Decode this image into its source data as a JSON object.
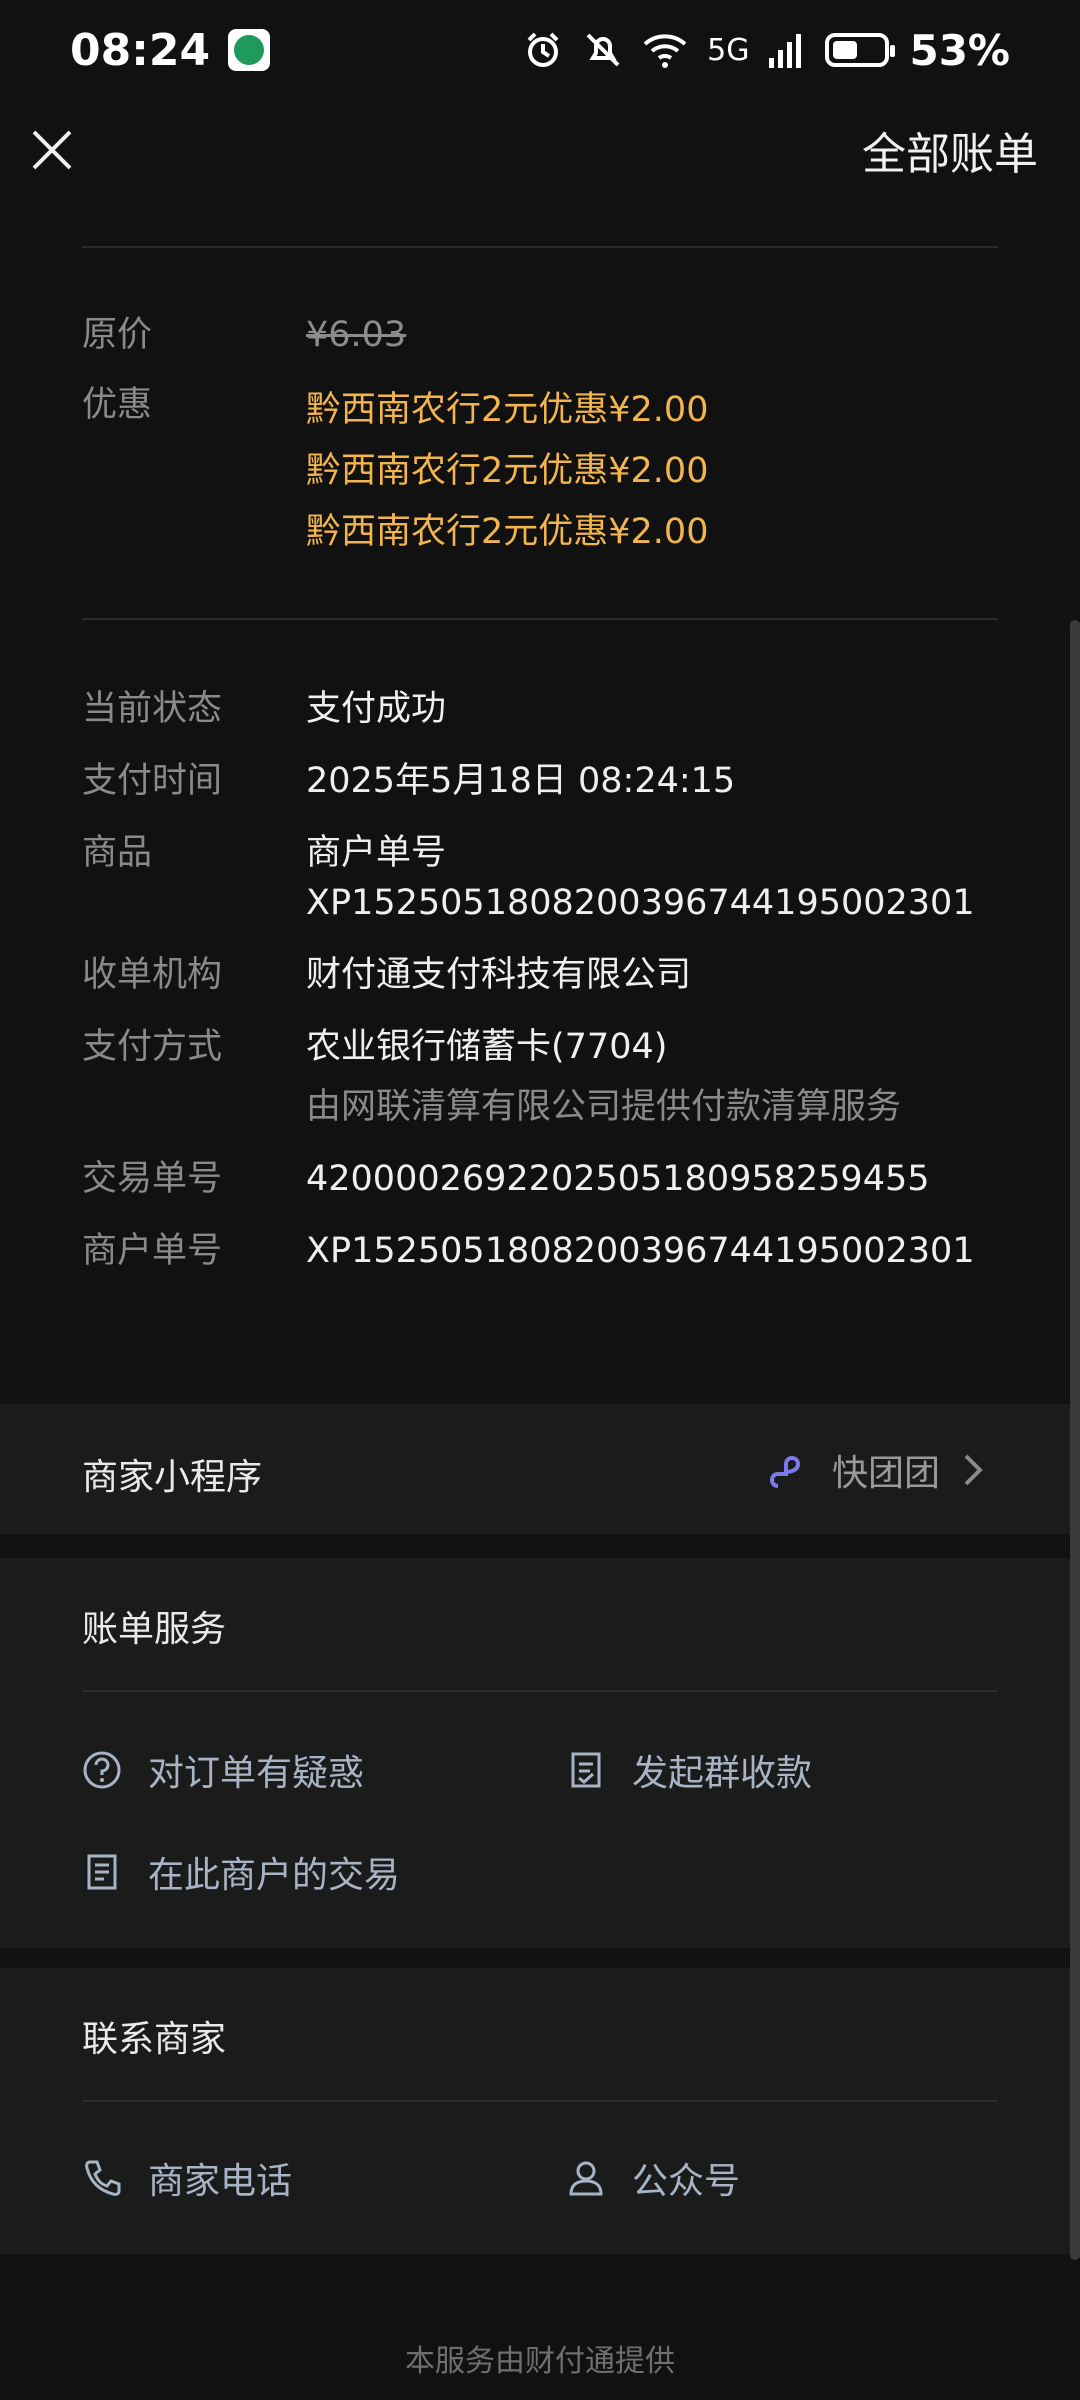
{
  "status_bar": {
    "time": "08:24",
    "network": "5G",
    "battery": "53%"
  },
  "header": {
    "right_link": "全部账单"
  },
  "price": {
    "original_label": "原价",
    "original_value": "¥6.03",
    "discount_label": "优惠",
    "discounts": [
      "黔西南农行2元优惠¥2.00",
      "黔西南农行2元优惠¥2.00",
      "黔西南农行2元优惠¥2.00"
    ]
  },
  "details": {
    "status": {
      "label": "当前状态",
      "value": "支付成功"
    },
    "pay_time": {
      "label": "支付时间",
      "value": "2025年5月18日 08:24:15"
    },
    "goods": {
      "label": "商品",
      "value_line1": "商户单号",
      "value_line2": "XP1525051808200396744195002301"
    },
    "acquirer": {
      "label": "收单机构",
      "value": "财付通支付科技有限公司"
    },
    "pay_method": {
      "label": "支付方式",
      "value": "农业银行储蓄卡(7704)",
      "note": "由网联清算有限公司提供付款清算服务"
    },
    "trade_no": {
      "label": "交易单号",
      "value": "4200002692202505180958259455"
    },
    "merchant_no": {
      "label": "商户单号",
      "value": "XP1525051808200396744195002301"
    }
  },
  "mini_program": {
    "label": "商家小程序",
    "name": "快团团"
  },
  "bill_service": {
    "title": "账单服务",
    "items": [
      "对订单有疑惑",
      "发起群收款",
      "在此商户的交易"
    ]
  },
  "contact": {
    "title": "联系商家",
    "items": [
      "商家电话",
      "公众号"
    ]
  },
  "footer": "本服务由财付通提供"
}
